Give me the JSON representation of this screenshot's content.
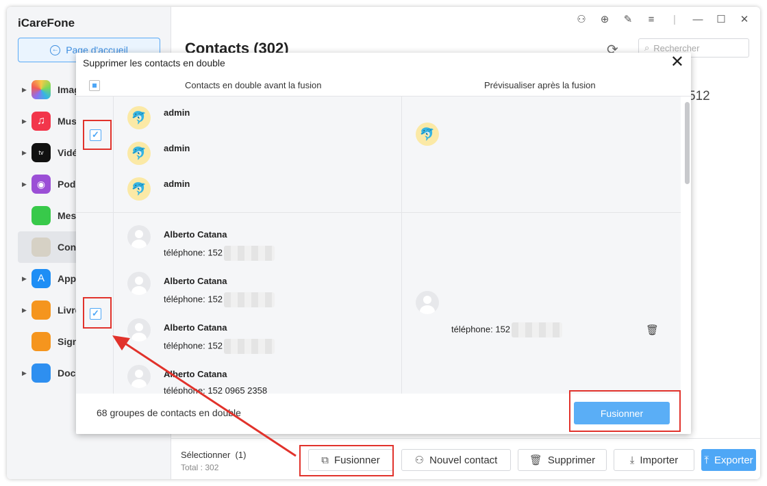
{
  "app": {
    "title": "iCareFone",
    "home_label": "Page d'accueil"
  },
  "sidebar": {
    "items": [
      {
        "label": "Images",
        "color": "#f25c54"
      },
      {
        "label": "Musique",
        "color": "#f2364b"
      },
      {
        "label": "Vidéos",
        "color": "#111111"
      },
      {
        "label": "Podcasts",
        "color": "#9b4fd6"
      },
      {
        "label": "Messages",
        "color": "#38c94a"
      },
      {
        "label": "Contacts",
        "color": "#c9c4b8"
      },
      {
        "label": "Applications",
        "color": "#1e8ef5"
      },
      {
        "label": "Livres",
        "color": "#f5951e"
      },
      {
        "label": "Signets",
        "color": "#f5951e"
      },
      {
        "label": "Documents",
        "color": "#2e8ff0"
      }
    ]
  },
  "main": {
    "title": "Contacts (302)",
    "search_placeholder": "Rechercher",
    "right_number": "512",
    "selected_label": "Sélectionner",
    "selected_count": "(1)",
    "total_label": "Total : 302"
  },
  "toolbar": {
    "merge_label": "Fusionner",
    "new_contact_label": "Nouvel contact",
    "delete_label": "Supprimer",
    "import_label": "Importer",
    "export_label": "Exporter"
  },
  "dialog": {
    "title": "Supprimer les contacts en double",
    "col_before": "Contacts en double avant la fusion",
    "col_after": "Prévisualiser après la fusion",
    "groups_text": "68 groupes de contacts en double",
    "merge_label": "Fusionner",
    "group1": {
      "names": [
        "admin",
        "admin",
        "admin"
      ]
    },
    "group2": {
      "names": [
        "Alberto Catana",
        "Alberto Catana",
        "Alberto Catana",
        "Alberto Catana"
      ],
      "phone_label": "téléphone: 152",
      "preview_phone": "téléphone: 152",
      "partial_phone": "téléphone: 152 0965 2358"
    }
  },
  "colors": {
    "accent": "#4ea7f6",
    "annotation": "#e1322b"
  }
}
